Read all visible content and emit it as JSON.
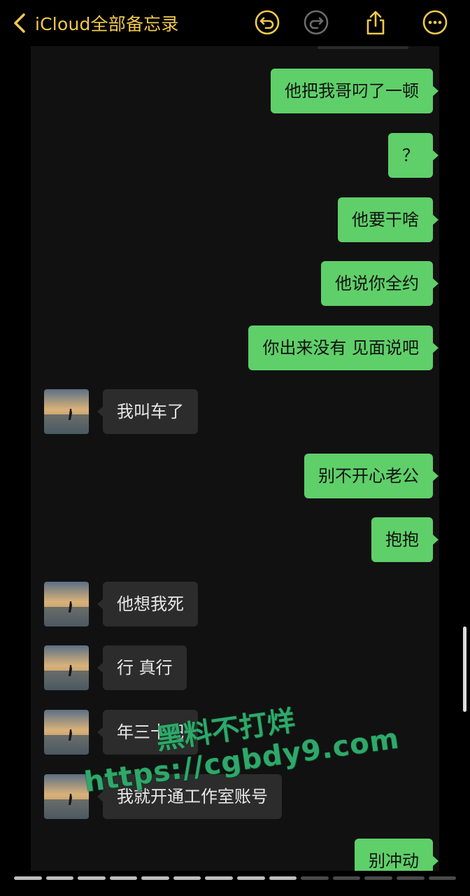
{
  "header": {
    "back_label": "iCloud全部备忘录",
    "icons": [
      "chevron-left-icon",
      "undo-icon",
      "redo-icon",
      "share-icon",
      "more-icon"
    ],
    "accent_color": "#f2c94c"
  },
  "messages": [
    {
      "side": "out",
      "text": "他把我哥叼了一顿"
    },
    {
      "side": "out",
      "text": "？"
    },
    {
      "side": "out",
      "text": "他要干啥"
    },
    {
      "side": "out",
      "text": "他说你全约"
    },
    {
      "side": "out",
      "text": "你出来没有 见面说吧"
    },
    {
      "side": "in",
      "text": "我叫车了"
    },
    {
      "side": "out",
      "text": "别不开心老公"
    },
    {
      "side": "out",
      "text": "抱抱"
    },
    {
      "side": "in",
      "text": "他想我死"
    },
    {
      "side": "in",
      "text": "行 真行"
    },
    {
      "side": "in",
      "text": "年三十吧"
    },
    {
      "side": "in",
      "text": "我就开通工作室账号"
    },
    {
      "side": "out",
      "text": "别冲动"
    }
  ],
  "colors": {
    "outgoing_bubble": "#5fcf69",
    "incoming_bubble": "#2c2c2c",
    "panel": "#111111"
  },
  "watermark": {
    "line1": "黑料不打烊",
    "line2": "https://cgbdy9.com"
  }
}
